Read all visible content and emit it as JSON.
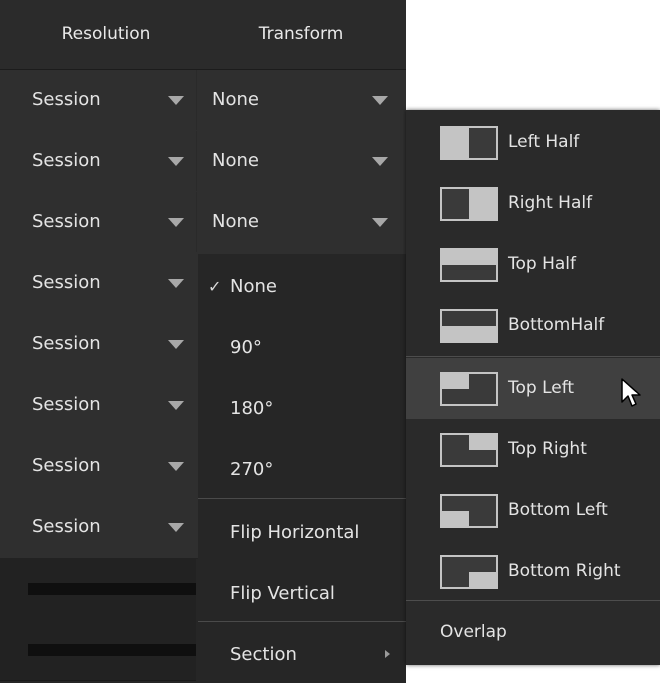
{
  "header": {
    "resolution": "Resolution",
    "transform": "Transform"
  },
  "rows": [
    {
      "resolution": "Session",
      "transform": "None"
    },
    {
      "resolution": "Session",
      "transform": "None"
    },
    {
      "resolution": "Session",
      "transform": "None"
    },
    {
      "resolution": "Session"
    },
    {
      "resolution": "Session"
    },
    {
      "resolution": "Session"
    },
    {
      "resolution": "Session"
    },
    {
      "resolution": "Session"
    }
  ],
  "transform_menu": {
    "check_mark": "✓",
    "items": [
      {
        "label": "None",
        "checked": true
      },
      {
        "label": "90°"
      },
      {
        "label": "180°"
      },
      {
        "label": "270°"
      },
      {
        "label": "Flip Horizontal"
      },
      {
        "label": "Flip Vertical"
      },
      {
        "label": "Section",
        "has_submenu": true
      }
    ]
  },
  "section_menu": {
    "items": [
      {
        "label": "Left Half",
        "icon": "left-half-icon"
      },
      {
        "label": "Right Half",
        "icon": "right-half-icon"
      },
      {
        "label": "Top Half",
        "icon": "top-half-icon"
      },
      {
        "label": "BottomHalf",
        "icon": "bottom-half-icon"
      },
      {
        "label": "Top Left",
        "icon": "top-left-icon",
        "highlighted": true
      },
      {
        "label": "Top Right",
        "icon": "top-right-icon"
      },
      {
        "label": "Bottom Left",
        "icon": "bottom-left-icon"
      },
      {
        "label": "Bottom Right",
        "icon": "bottom-right-icon"
      }
    ],
    "overlap": "Overlap"
  },
  "colors": {
    "panel": "#2f2f2f",
    "menu": "#262626",
    "highlight": "#404040",
    "icon": "#c4c4c4"
  }
}
